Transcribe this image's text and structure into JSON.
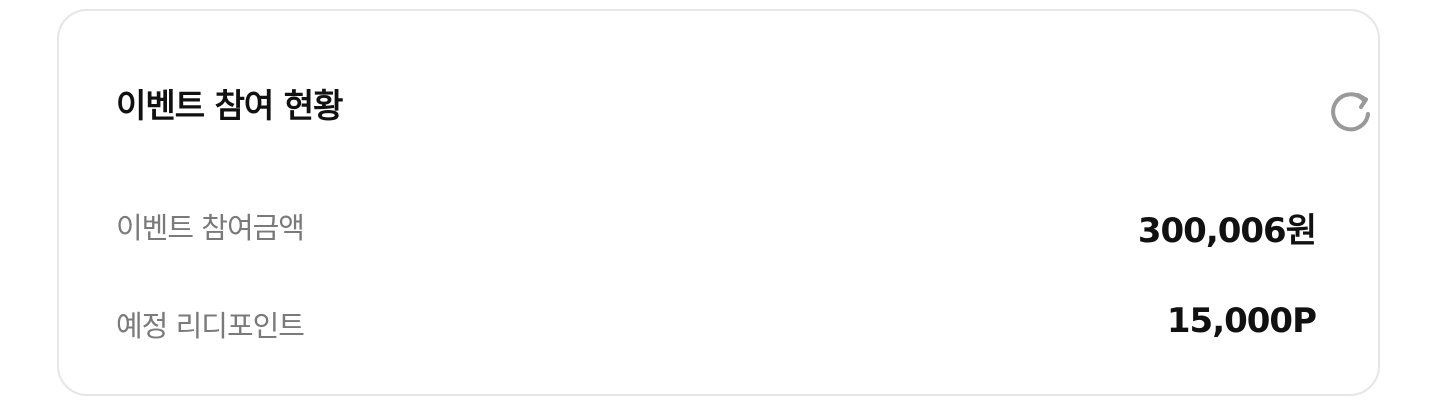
{
  "card": {
    "title": "이벤트 참여 현황",
    "refresh_icon": "refresh-icon",
    "rows": [
      {
        "label": "이벤트 참여금액",
        "value": "300,006원"
      },
      {
        "label": "예정 리디포인트",
        "value": "15,000P"
      }
    ]
  },
  "colors": {
    "border": "#e6e6e6",
    "title": "#111111",
    "label": "#7a7a7a",
    "icon": "#999999"
  }
}
